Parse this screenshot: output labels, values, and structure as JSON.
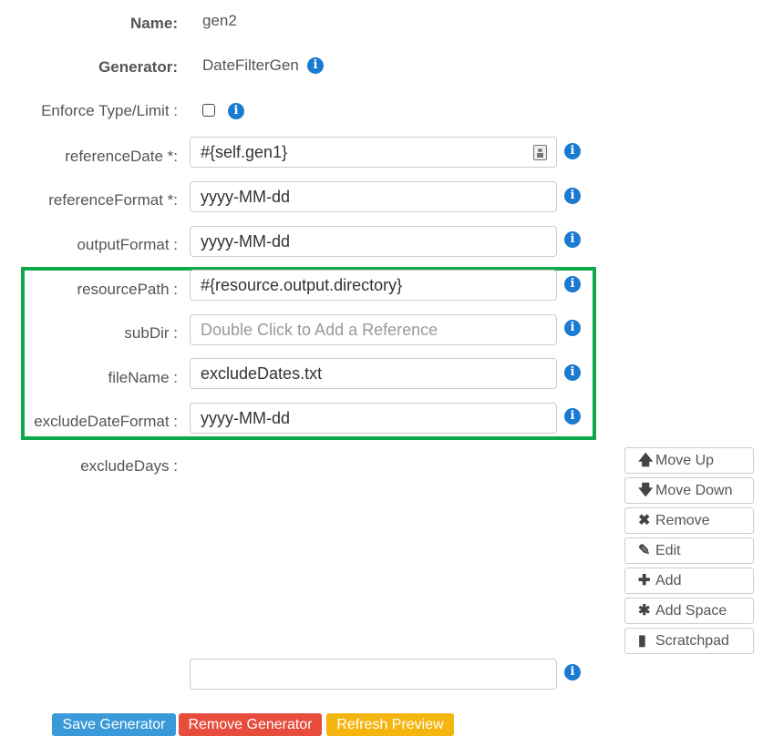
{
  "form": {
    "name": {
      "label": "Name:",
      "value": "gen2"
    },
    "generator": {
      "label": "Generator:",
      "value": "DateFilterGen"
    },
    "enforce": {
      "label": "Enforce Type/Limit :"
    },
    "referenceDate": {
      "label": "referenceDate *:",
      "value": "#{self.gen1}"
    },
    "referenceFormat": {
      "label": "referenceFormat *:",
      "value": "yyyy-MM-dd"
    },
    "outputFormat": {
      "label": "outputFormat :",
      "value": "yyyy-MM-dd"
    },
    "resourcePath": {
      "label": "resourcePath :",
      "value": "#{resource.output.directory}"
    },
    "subDir": {
      "label": "subDir :",
      "placeholder": "Double Click to Add a Reference"
    },
    "fileName": {
      "label": "fileName :",
      "value": "excludeDates.txt"
    },
    "excludeDateFormat": {
      "label": "excludeDateFormat :",
      "value": "yyyy-MM-dd"
    },
    "excludeDays": {
      "label": "excludeDays :",
      "value": ""
    }
  },
  "info_glyph": "i",
  "side_buttons": [
    {
      "icon": "arrow-up-icon",
      "glyph": "🡅",
      "label": "Move Up"
    },
    {
      "icon": "arrow-down-icon",
      "glyph": "🡇",
      "label": "Move Down"
    },
    {
      "icon": "close-icon",
      "glyph": "✖",
      "label": "Remove"
    },
    {
      "icon": "pencil-icon",
      "glyph": "✎",
      "label": "Edit"
    },
    {
      "icon": "plus-icon",
      "glyph": "✚",
      "label": "Add"
    },
    {
      "icon": "asterisk-icon",
      "glyph": "✱",
      "label": "Add Space"
    },
    {
      "icon": "file-icon",
      "glyph": "▮",
      "label": "Scratchpad"
    }
  ],
  "actions": {
    "save": "Save Generator",
    "remove": "Remove Generator",
    "refresh": "Refresh Preview"
  },
  "colors": {
    "highlight": "#0fa84a",
    "info": "#1a7bd0",
    "save": "#3a9ad9",
    "remove": "#e74c3c",
    "refresh": "#f5b50f"
  }
}
